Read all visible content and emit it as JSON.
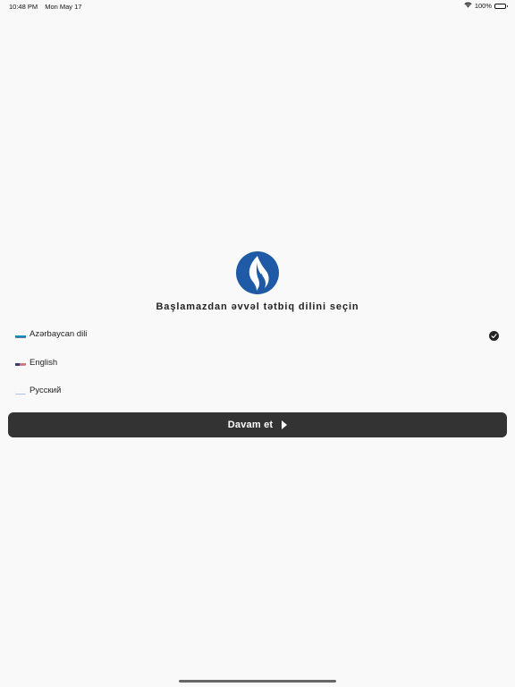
{
  "status_bar": {
    "time": "10:48 PM",
    "date": "Mon May 17",
    "battery_percent": "100%",
    "battery_level": 1.0,
    "icons": [
      "wifi-icon",
      "battery-icon"
    ]
  },
  "logo": {
    "icon": "flame-logo-icon",
    "color": "#1f5aa6"
  },
  "headline": "Başlamazdan əvvəl tətbiq dilini seçin",
  "languages": [
    {
      "label": "Azərbaycan dili",
      "flag": "azerbaijan-flag-icon",
      "selected": true
    },
    {
      "label": "English",
      "flag": "us-flag-icon",
      "selected": false
    },
    {
      "label": "Русский",
      "flag": "russia-flag-icon",
      "selected": false
    }
  ],
  "continue_button": {
    "label": "Davam et",
    "icon": "play-icon",
    "background": "#333333"
  },
  "colors": {
    "background": "#f9f9f9",
    "text": "#222222"
  }
}
